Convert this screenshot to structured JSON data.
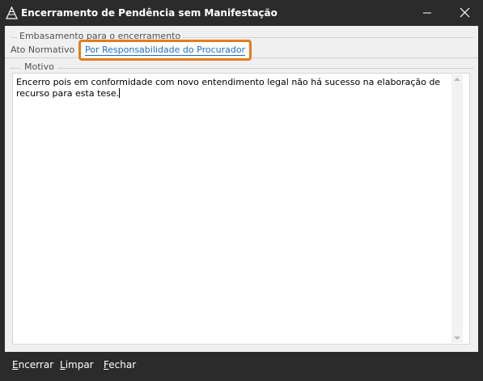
{
  "window": {
    "title": "Encerramento de Pendência sem Manifestação",
    "icon": "app-triangle-icon",
    "controls": [
      "minimize-icon",
      "close-icon"
    ]
  },
  "basis_group": {
    "legend": "Embasamento para o encerramento",
    "tabs": [
      {
        "label": "Ato Normativo",
        "selected": false
      },
      {
        "label": "Por Responsabilidade do Procurador",
        "selected": true
      }
    ]
  },
  "motivo_group": {
    "legend": "Motivo",
    "text": "Encerro pois em conformidade com novo entendimento legal não há sucesso na elaboração de recurso para esta tese."
  },
  "actions": {
    "encerrar": {
      "first": "E",
      "rest": "ncerrar"
    },
    "limpar": {
      "first": "L",
      "rest": "impar"
    },
    "fechar": {
      "first": "F",
      "rest": "echar"
    }
  },
  "colors": {
    "highlight": "#e47d1c",
    "selected_tab_text": "#1c6cc3",
    "chrome": "#2b2b2b"
  }
}
